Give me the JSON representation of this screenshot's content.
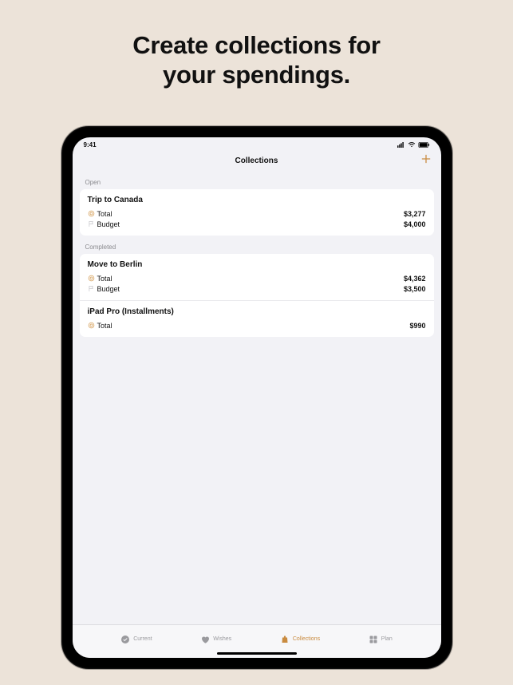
{
  "hero": {
    "line1": "Create collections for",
    "line2": "your spendings."
  },
  "status": {
    "time": "9:41"
  },
  "nav": {
    "title": "Collections"
  },
  "sections": {
    "open": {
      "header": "Open",
      "items": [
        {
          "title": "Trip to Canada",
          "rows": [
            {
              "icon": "coin",
              "label": "Total",
              "value": "$3,277"
            },
            {
              "icon": "flag",
              "label": "Budget",
              "value": "$4,000"
            }
          ]
        }
      ]
    },
    "completed": {
      "header": "Completed",
      "items": [
        {
          "title": "Move to Berlin",
          "rows": [
            {
              "icon": "coin",
              "label": "Total",
              "value": "$4,362"
            },
            {
              "icon": "flag",
              "label": "Budget",
              "value": "$3,500"
            }
          ]
        },
        {
          "title": "iPad Pro (Installments)",
          "rows": [
            {
              "icon": "coin",
              "label": "Total",
              "value": "$990"
            }
          ]
        }
      ]
    }
  },
  "tabs": [
    {
      "id": "current",
      "label": "Current",
      "active": false
    },
    {
      "id": "wishes",
      "label": "Wishes",
      "active": false
    },
    {
      "id": "collections",
      "label": "Collections",
      "active": true
    },
    {
      "id": "plan",
      "label": "Plan",
      "active": false
    }
  ],
  "colors": {
    "accent": "#c98b40"
  }
}
